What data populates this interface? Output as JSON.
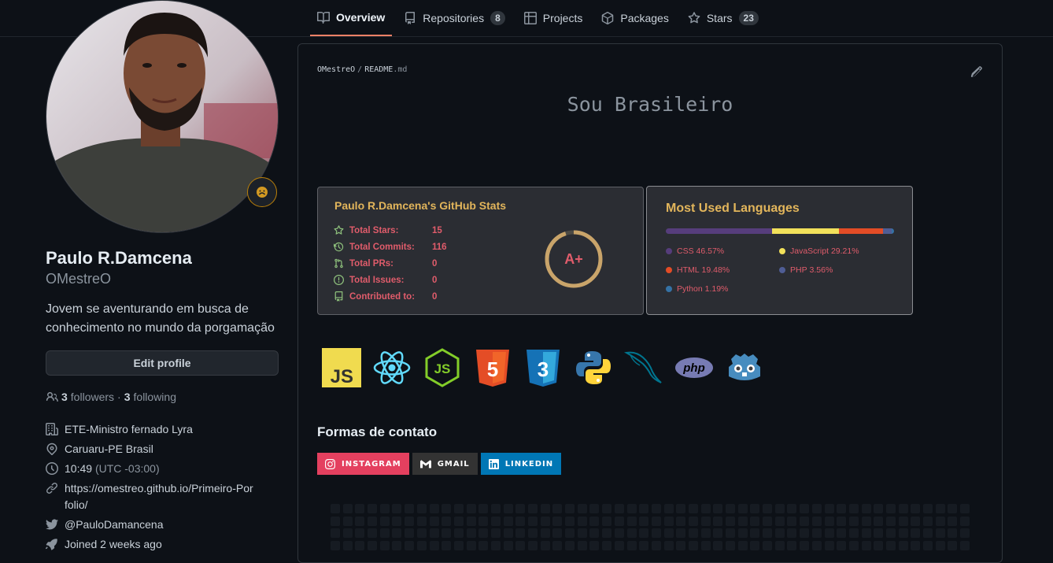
{
  "nav": {
    "tabs": [
      {
        "label": "Overview",
        "icon": "book-icon",
        "selected": true
      },
      {
        "label": "Repositories",
        "icon": "repo-icon",
        "count": "8"
      },
      {
        "label": "Projects",
        "icon": "table-icon"
      },
      {
        "label": "Packages",
        "icon": "package-icon"
      },
      {
        "label": "Stars",
        "icon": "star-icon",
        "count": "23"
      }
    ]
  },
  "profile": {
    "full_name": "Paulo R.Damcena",
    "username": "OMestreO",
    "bio": "Jovem se aventurando em busca de conhecimento no mundo da porgamação",
    "edit_label": "Edit profile",
    "followers_count": "3",
    "followers_label": "followers",
    "following_count": "3",
    "following_label": "following",
    "dot": "·",
    "organization": "ETE-Ministro fernado Lyra",
    "location": "Caruaru-PE Brasil",
    "time": "10:49",
    "timezone": "(UTC -03:00)",
    "website": "https://omestreo.github.io/Primeiro-Porfolio/",
    "twitter": "@PauloDamancena",
    "joined": "Joined 2 weeks ago"
  },
  "readme": {
    "owner": "OMestreO",
    "sep": "/",
    "file": "README",
    "ext": ".md",
    "heading": "Sou Brasileiro"
  },
  "stats_card": {
    "title": "Paulo R.Damcena's GitHub Stats",
    "rows": [
      {
        "label": "Total Stars:",
        "value": "15",
        "icon": "star-icon"
      },
      {
        "label": "Total Commits:",
        "value": "116",
        "icon": "history-icon"
      },
      {
        "label": "Total PRs:",
        "value": "0",
        "icon": "pull-request-icon"
      },
      {
        "label": "Total Issues:",
        "value": "0",
        "icon": "issue-icon"
      },
      {
        "label": "Contributed to:",
        "value": "0",
        "icon": "repo-icon"
      }
    ],
    "grade": "A+",
    "grade_progress": 0.95
  },
  "languages_card": {
    "title": "Most Used Languages",
    "items": [
      {
        "name": "CSS",
        "percent": "46.57%",
        "value": 46.57,
        "color": "#563d7c"
      },
      {
        "name": "JavaScript",
        "percent": "29.21%",
        "value": 29.21,
        "color": "#f1e05a"
      },
      {
        "name": "HTML",
        "percent": "19.48%",
        "value": 19.48,
        "color": "#e34c26"
      },
      {
        "name": "PHP",
        "percent": "3.56%",
        "value": 3.56,
        "color": "#4F5D95"
      },
      {
        "name": "Python",
        "percent": "1.19%",
        "value": 1.19,
        "color": "#3572A5"
      }
    ]
  },
  "tech_icons": [
    "javascript-icon",
    "react-icon",
    "nodejs-icon",
    "html5-icon",
    "css3-icon",
    "python-icon",
    "mysql-icon",
    "php-icon",
    "godot-icon"
  ],
  "contact": {
    "title": "Formas de contato",
    "badges": [
      {
        "label": "INSTAGRAM",
        "color": "#E4405F",
        "icon": "instagram-icon"
      },
      {
        "label": "GMAIL",
        "color": "#333333",
        "icon": "gmail-icon"
      },
      {
        "label": "LINKEDIN",
        "color": "#0077B5",
        "icon": "linkedin-icon"
      }
    ]
  }
}
